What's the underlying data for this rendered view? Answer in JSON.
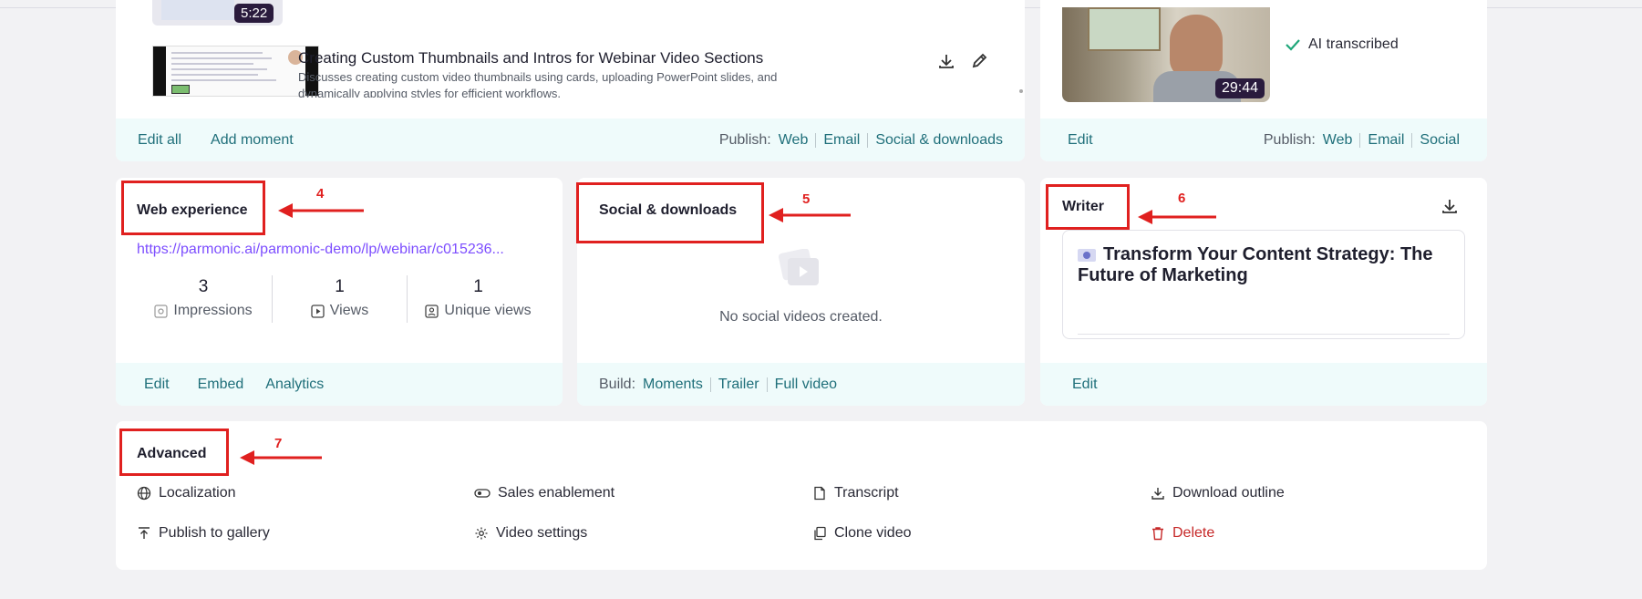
{
  "moments": {
    "first_duration": "5:22",
    "item_title": "Creating Custom Thumbnails and Intros for Webinar Video Sections",
    "item_desc": "Discusses creating custom video thumbnails using cards, uploading PowerPoint slides, and dynamically applying styles for efficient workflows.",
    "edit_all": "Edit all",
    "add_moment": "Add moment",
    "publish_label": "Publish:",
    "publish_web": "Web",
    "publish_email": "Email",
    "publish_social": "Social & downloads"
  },
  "fullvideo": {
    "duration": "29:44",
    "ai_status": "AI transcribed",
    "edit": "Edit",
    "publish_label": "Publish:",
    "publish_web": "Web",
    "publish_email": "Email",
    "publish_social": "Social"
  },
  "web": {
    "title": "Web experience",
    "url": "https://parmonic.ai/parmonic-demo/lp/webinar/c015236...",
    "impressions": "3",
    "impressions_label": "Impressions",
    "views": "1",
    "views_label": "Views",
    "unique": "1",
    "unique_label": "Unique views",
    "edit": "Edit",
    "embed": "Embed",
    "analytics": "Analytics"
  },
  "social": {
    "title": "Social & downloads",
    "empty": "No social videos created.",
    "build_label": "Build:",
    "moments": "Moments",
    "trailer": "Trailer",
    "full_video": "Full video"
  },
  "writer": {
    "title": "Writer",
    "doc_title": "Transform Your Content Strategy: The Future of Marketing",
    "edit": "Edit"
  },
  "advanced": {
    "title": "Advanced",
    "localization": "Localization",
    "sales": "Sales enablement",
    "transcript": "Transcript",
    "download_outline": "Download outline",
    "publish_gallery": "Publish to gallery",
    "video_settings": "Video settings",
    "clone": "Clone video",
    "delete": "Delete"
  },
  "annotations": {
    "n4": "4",
    "n5": "5",
    "n6": "6",
    "n7": "7"
  },
  "colors": {
    "accent_teal": "#1f6f7a",
    "link_purple": "#7c4dff",
    "annotation_red": "#e0201f",
    "delete_red": "#c62828"
  }
}
